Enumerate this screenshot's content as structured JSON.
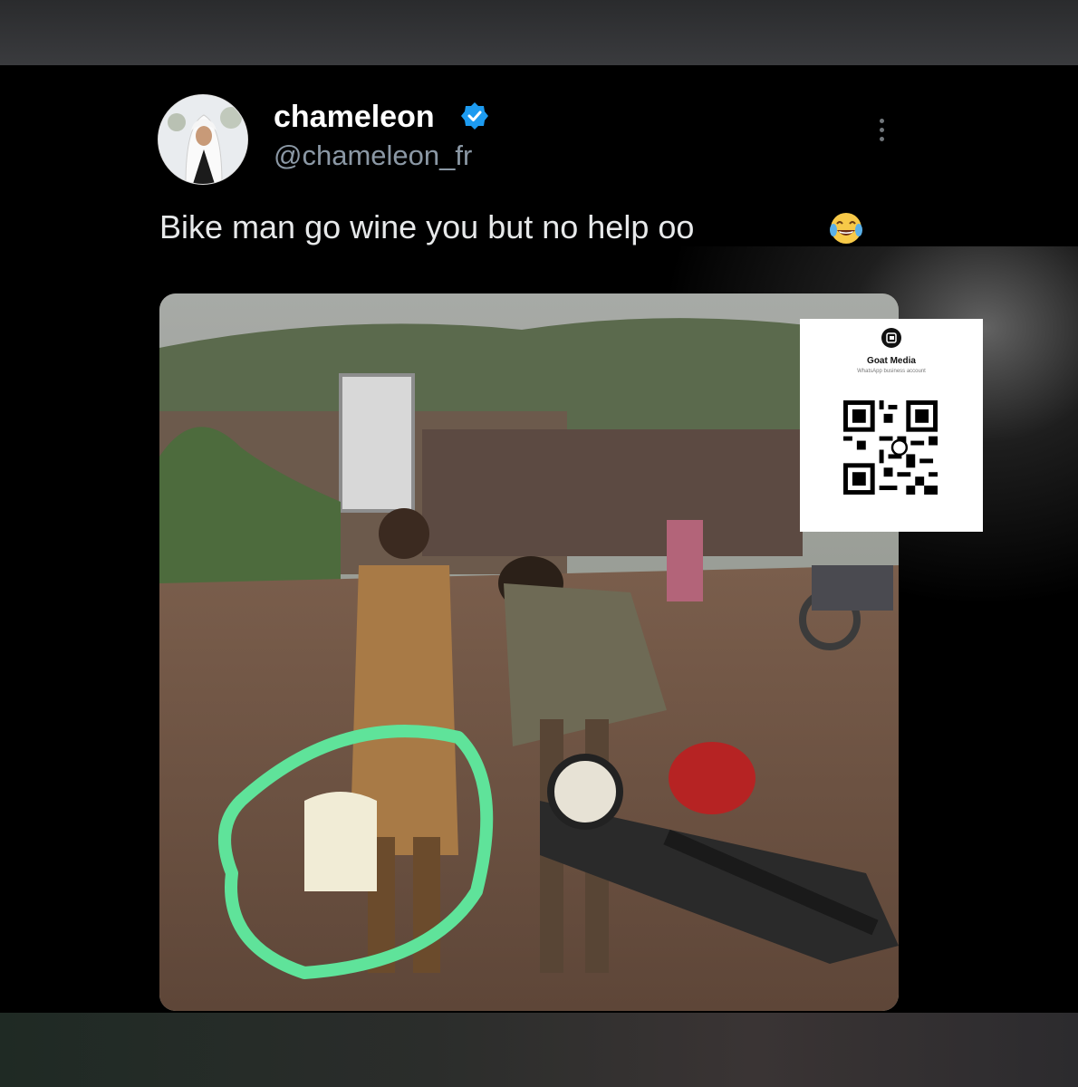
{
  "post": {
    "display_name": "chameleon",
    "handle": "@chameleon_fr",
    "text": "Bike man go wine you but no help oo",
    "emoji": "face-with-tears-of-joy-icon",
    "more_icon": "more-options-icon",
    "verified_icon": "verified-badge-icon"
  },
  "qr_card": {
    "title": "Goat Media",
    "subtitle": "WhatsApp business account"
  },
  "colors": {
    "background": "#000000",
    "verified_blue": "#1d9bf0",
    "handle_gray": "#8b98a5",
    "highlight_green": "#5fe39a"
  }
}
